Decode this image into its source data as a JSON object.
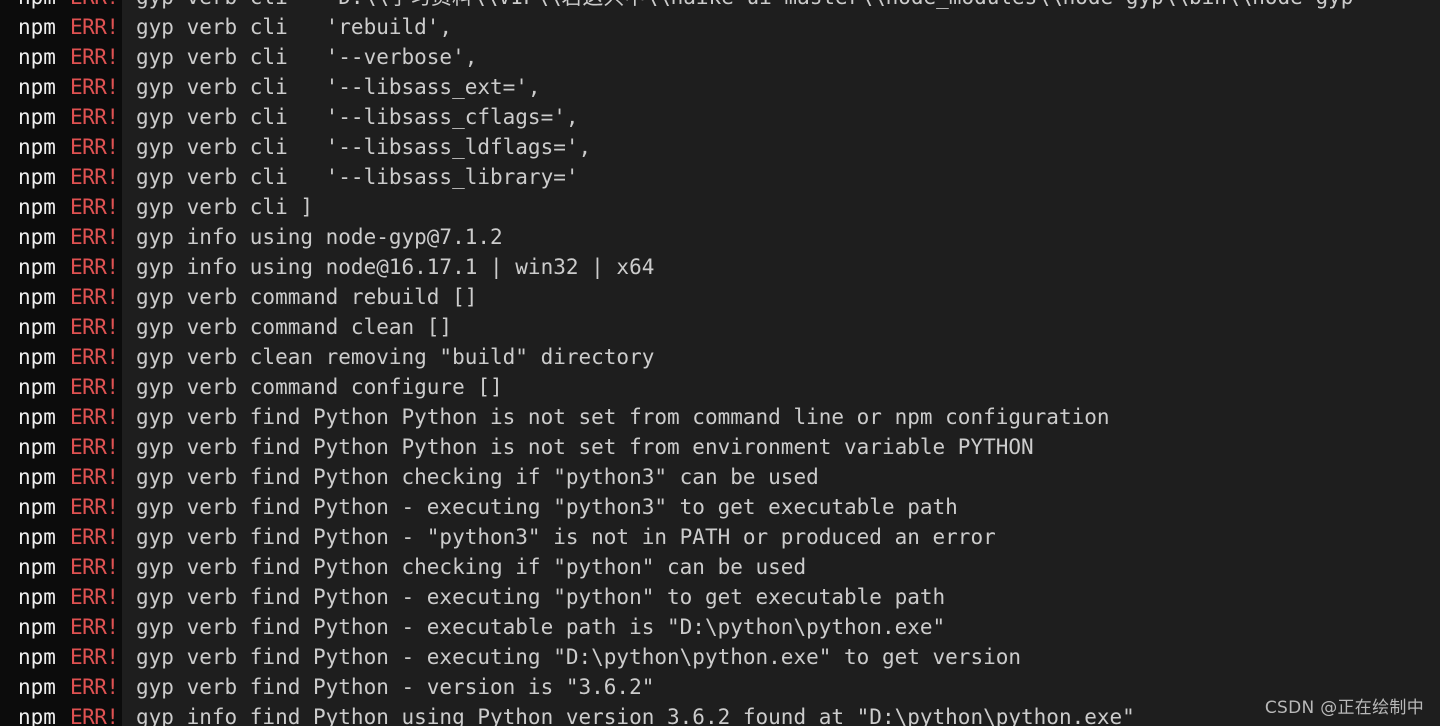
{
  "terminal": {
    "prefix_npm": "npm",
    "prefix_err": "ERR!",
    "lines": [
      "gyp verb cli   'D:\\\\学习资料\\\\VIP\\\\若这只中\\\\haike-ui-master\\\\node_modules\\\\node-gyp\\\\bin\\\\node-gyp",
      "gyp verb cli   'rebuild',",
      "gyp verb cli   '--verbose',",
      "gyp verb cli   '--libsass_ext=',",
      "gyp verb cli   '--libsass_cflags=',",
      "gyp verb cli   '--libsass_ldflags=',",
      "gyp verb cli   '--libsass_library='",
      "gyp verb cli ]",
      "gyp info using node-gyp@7.1.2",
      "gyp info using node@16.17.1 | win32 | x64",
      "gyp verb command rebuild []",
      "gyp verb command clean []",
      "gyp verb clean removing \"build\" directory",
      "gyp verb command configure []",
      "gyp verb find Python Python is not set from command line or npm configuration",
      "gyp verb find Python Python is not set from environment variable PYTHON",
      "gyp verb find Python checking if \"python3\" can be used",
      "gyp verb find Python - executing \"python3\" to get executable path",
      "gyp verb find Python - \"python3\" is not in PATH or produced an error",
      "gyp verb find Python checking if \"python\" can be used",
      "gyp verb find Python - executing \"python\" to get executable path",
      "gyp verb find Python - executable path is \"D:\\python\\python.exe\"",
      "gyp verb find Python - executing \"D:\\python\\python.exe\" to get version",
      "gyp verb find Python - version is \"3.6.2\"",
      "gyp info find Python using Python version 3.6.2 found at \"D:\\python\\python.exe\""
    ]
  },
  "watermark": "CSDN @正在绘制中",
  "colors": {
    "background": "#1e1e1e",
    "prefix_background": "#0c0c0c",
    "text": "#cccccc",
    "err": "#e05252"
  }
}
